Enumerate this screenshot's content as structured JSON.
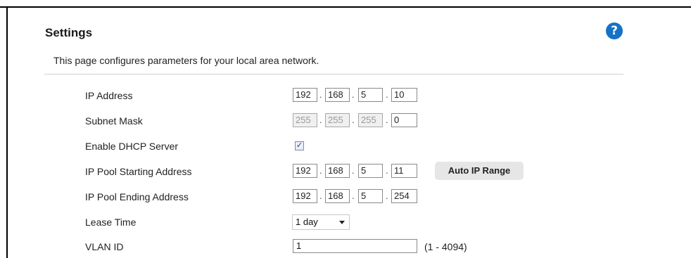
{
  "header": {
    "title": "Settings",
    "help_icon_glyph": "?"
  },
  "description": "This page configures parameters for your local area network.",
  "fields": {
    "ip_address": {
      "label": "IP Address",
      "octets": [
        "192",
        "168",
        "5",
        "10"
      ]
    },
    "subnet_mask": {
      "label": "Subnet Mask",
      "octets": [
        "255",
        "255",
        "255",
        "0"
      ]
    },
    "dhcp": {
      "label": "Enable DHCP Server",
      "checked": true,
      "check_glyph": "✓"
    },
    "pool_start": {
      "label": "IP Pool Starting Address",
      "octets": [
        "192",
        "168",
        "5",
        "11"
      ]
    },
    "pool_end": {
      "label": "IP Pool Ending Address",
      "octets": [
        "192",
        "168",
        "5",
        "254"
      ]
    },
    "lease_time": {
      "label": "Lease Time",
      "value": "1 day"
    },
    "vlan_id": {
      "label": "VLAN ID",
      "value": "1",
      "hint": "(1 - 4094)"
    }
  },
  "buttons": {
    "auto_ip_range": "Auto IP Range"
  },
  "icons": {
    "help": "help-circle-icon",
    "dropdown": "chevron-down-icon"
  },
  "colors": {
    "accent": "#1572c6",
    "divider": "#d0d0d0"
  }
}
